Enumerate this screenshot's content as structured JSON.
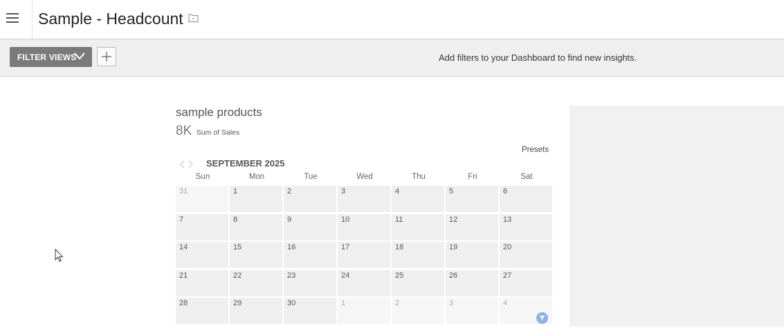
{
  "header": {
    "title": "Sample - Headcount",
    "menu_icon": "hamburger-icon",
    "folder_icon": "folder-icon"
  },
  "filterbar": {
    "filter_views_label": "FILTER VIEWS",
    "add_icon": "plus-icon",
    "hint": "Add filters to your Dashboard to find new insights."
  },
  "widget": {
    "title": "sample products",
    "metric_value": "8K",
    "metric_label": "Sum of Sales",
    "presets_label": "Presets",
    "month_label": "SEPTEMBER 2025",
    "weekdays": [
      "Sun",
      "Mon",
      "Tue",
      "Wed",
      "Thu",
      "Fri",
      "Sat"
    ],
    "weeks": [
      [
        {
          "d": "31",
          "out": true
        },
        {
          "d": "1"
        },
        {
          "d": "2"
        },
        {
          "d": "3"
        },
        {
          "d": "4"
        },
        {
          "d": "5"
        },
        {
          "d": "6"
        }
      ],
      [
        {
          "d": "7"
        },
        {
          "d": "8"
        },
        {
          "d": "9"
        },
        {
          "d": "10"
        },
        {
          "d": "11"
        },
        {
          "d": "12"
        },
        {
          "d": "13"
        }
      ],
      [
        {
          "d": "14"
        },
        {
          "d": "15"
        },
        {
          "d": "16"
        },
        {
          "d": "17"
        },
        {
          "d": "18"
        },
        {
          "d": "19"
        },
        {
          "d": "20"
        }
      ],
      [
        {
          "d": "21"
        },
        {
          "d": "22"
        },
        {
          "d": "23"
        },
        {
          "d": "24"
        },
        {
          "d": "25"
        },
        {
          "d": "26"
        },
        {
          "d": "27"
        }
      ],
      [
        {
          "d": "28"
        },
        {
          "d": "29"
        },
        {
          "d": "30"
        },
        {
          "d": "1",
          "out": true
        },
        {
          "d": "2",
          "out": true
        },
        {
          "d": "3",
          "out": true
        },
        {
          "d": "4",
          "out": true
        }
      ]
    ]
  },
  "colors": {
    "filter_button": "#7a7a7a",
    "filter_badge": "#8fb0e0",
    "cell_bg": "#efefef"
  }
}
